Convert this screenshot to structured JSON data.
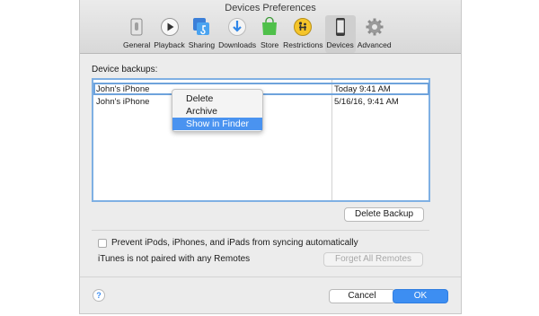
{
  "window": {
    "title": "Devices Preferences"
  },
  "toolbar": {
    "items": [
      {
        "label": "General",
        "icon": "general-switch-icon"
      },
      {
        "label": "Playback",
        "icon": "play-icon"
      },
      {
        "label": "Sharing",
        "icon": "sharing-music-icon"
      },
      {
        "label": "Downloads",
        "icon": "download-icon"
      },
      {
        "label": "Store",
        "icon": "store-bag-icon"
      },
      {
        "label": "Restrictions",
        "icon": "restrictions-icon"
      },
      {
        "label": "Devices",
        "icon": "iphone-icon",
        "active": true
      },
      {
        "label": "Advanced",
        "icon": "gear-icon"
      }
    ]
  },
  "backups": {
    "label": "Device backups:",
    "rows": [
      {
        "name": "John's iPhone",
        "date": "Today 9:41 AM"
      },
      {
        "name": "John's iPhone",
        "date": "5/16/16, 9:41 AM"
      }
    ]
  },
  "context_menu": {
    "items": [
      "Delete",
      "Archive",
      "Show in Finder"
    ],
    "selected": "Show in Finder"
  },
  "buttons": {
    "delete_backup": "Delete Backup",
    "forget_remotes": "Forget All Remotes",
    "cancel": "Cancel",
    "ok": "OK",
    "help": "?"
  },
  "options": {
    "prevent_sync_label": "Prevent iPods, iPhones, and iPads from syncing automatically",
    "prevent_sync_checked": false,
    "remotes_status": "iTunes is not paired with any Remotes"
  },
  "colors": {
    "accent": "#3d8ef2",
    "selection": "#4a93f0",
    "focus_ring": "#7fb0e3"
  }
}
